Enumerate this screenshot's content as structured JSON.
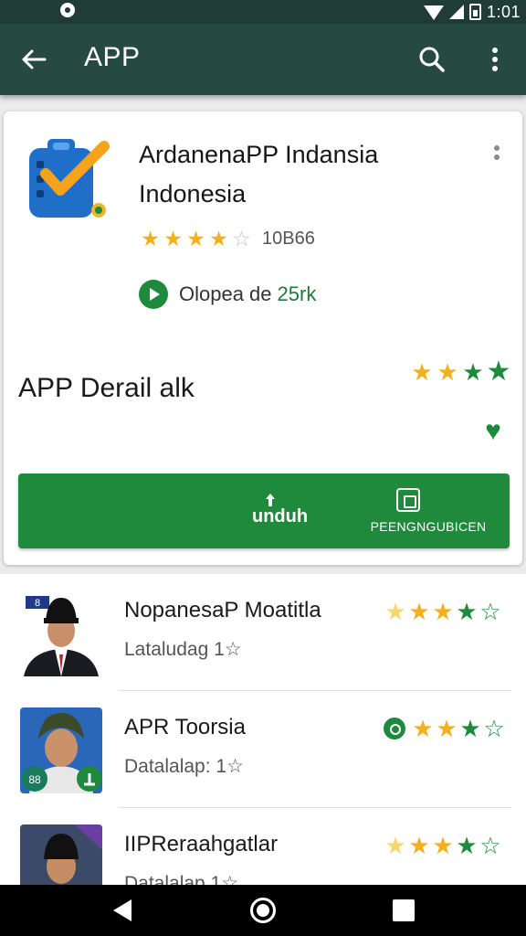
{
  "status_bar": {
    "time": "1:01"
  },
  "app_bar": {
    "title": "APP"
  },
  "app": {
    "title": "ArdanenaPP Indansia Indonesia",
    "rating": 4,
    "rating_max": 5,
    "review_count": "10B66",
    "opened_text": "Olopea de",
    "opened_count": "25rk",
    "detail_title": "APP Derail alk",
    "download_label": "unduh",
    "install_label": "PEENGNGUBICEN",
    "colors": {
      "accent": "#1f8a3c",
      "app_bar": "#264a42",
      "star": "#f2b01e"
    }
  },
  "list": {
    "items": [
      {
        "title": "NopanesaP Moatitla",
        "subtitle": "Lataludag 1",
        "avatar_badge": "8",
        "has_chat_icon": false
      },
      {
        "title": "APR Toorsia",
        "subtitle": "Datalalap: 1",
        "avatar_badge": "88",
        "has_chat_icon": true
      },
      {
        "title": "IIPReraahgatlar",
        "subtitle": "Datalalap 1",
        "avatar_badge": "",
        "has_chat_icon": false
      }
    ]
  }
}
